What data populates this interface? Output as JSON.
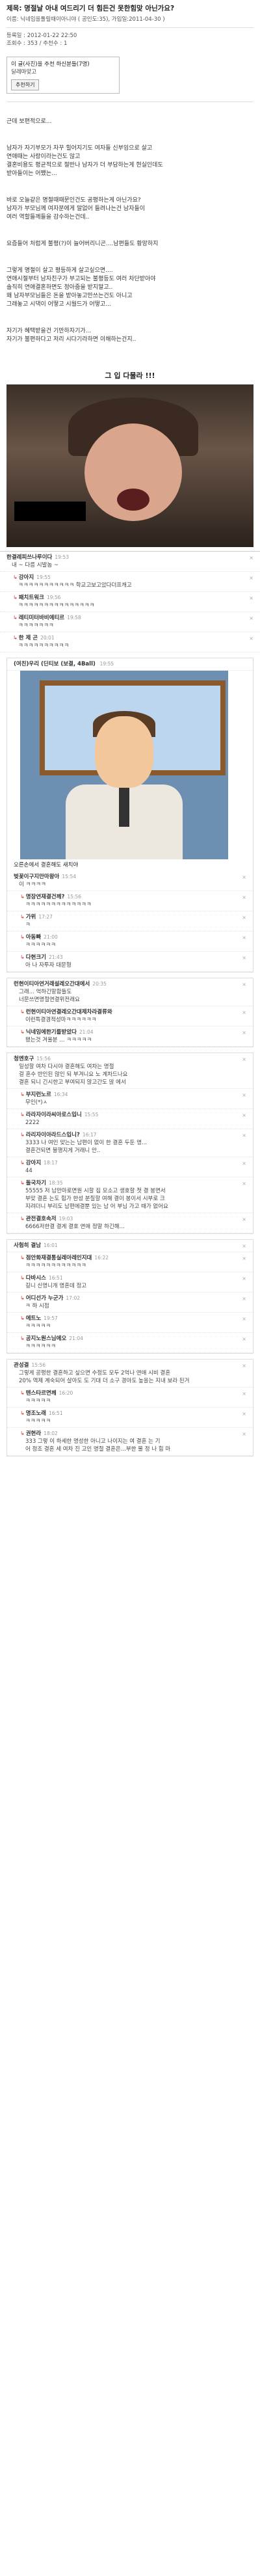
{
  "post": {
    "title": "제목: 명절날 아내 여드리기 더 힘든건 못한힘맞 아닌가요?",
    "meta1": "이름: 닉네임을톨릴때이아니야 ( 공인도:35), 가입일:2011-04-30 )",
    "meta2": "등록일 : 2012-01-22 22:50",
    "meta3": "조회수 : 353 / 추천수 : 1",
    "rec_line": "이 글(사진)을 추천 하신분들(7명)",
    "rec_user": "딜레마맞고",
    "rec_button": "추천하기",
    "lines": [
      "근데 보편적으로...",
      "남자가 자기부모가 자꾸 힐어지기도 여자들 신부임으로 살고",
      "연애때는 사랑이라는건도 않고",
      "결혼비용도 평균적으로 절반나 남자가 더 부담하는게 현실인데도",
      "받아들이는 어쨌는...",
      "바로 오늘같은 명절때때문인건도 공평하는게 아닌가요?",
      "남자가 부모님께 여자분에게 말없어 들려나는건 남자들이",
      "여러 역할들께들을 감수하는건데..",
      "요즘들어 처럼게 불평(?)이 늘어버리니곤....남편들도 황망하지",
      "그렇게 명절이 살고 평등하게 살고싶으면....",
      "연애시절부터 남자친구가 부고되는 불평등도 여러 차단받아야",
      "솔직히 연애결혼하면도 정아줌을 받지말고..",
      "왜 남자부모님들은 돈을 받아놓고만쓰는건도 아니고",
      "그래놓고 시댁이 어떻고 시월드가 어떻고...",
      "자기가 혜택받을건 기만하자기가...",
      "자기가 불편하다고 저리 시다기라하면 이해하는건지.."
    ],
    "image_caption": "그 입 다물라 !!!"
  },
  "comments1": [
    {
      "nick": "한결레피쓰나루이다",
      "time": "19:53",
      "text": "내 ~ 다름 시발놈 ~"
    },
    {
      "nick": "강아지",
      "time": "19:55",
      "text": "ㅋㅋㅋㅋㅋㅋㅋㅋㅋㅋㅋ 학교고보고았다더프캐고"
    },
    {
      "nick": "패치트워크",
      "time": "19:56",
      "text": "ㅋㅋㅋㅋㅋㅋㅋㅋㅋㅋㅋㅋㅋㅋㅋ"
    },
    {
      "nick": "레티미터바비에티르",
      "time": "19:58",
      "text": "ㅋㅋㅋㅋㅋㅋㅋ"
    },
    {
      "nick": "한 제 곤",
      "time": "20:01",
      "text": "ㅋㅋㅋㅋㅋㅋㅋㅋㅋㅋ"
    }
  ],
  "comments2_header": {
    "nick": "(여친)우리 (딘티보 (보결, 4Ball)",
    "time": "19:55"
  },
  "comments2_caption": "오른손에서 결혼해도 새치야",
  "comments2": [
    {
      "nick": "벚꽃이구지만마왕아",
      "time": "15:54",
      "text": "이 ㅋㅋㅋㅋ"
    },
    {
      "nick": "명장연재결건께?",
      "time": "15:56",
      "text": "ㅋㅋㅋㅋㅋㅋㅋㅋㅋㅋㅋㅋㅋ"
    },
    {
      "nick": "가위",
      "time": "17:27",
      "text": "ㅋ"
    },
    {
      "nick": "아동빠",
      "time": "21:00",
      "text": "ㅋㅋㅋㅋㅋㅋ"
    },
    {
      "nick": "다현크기",
      "time": "21:43",
      "text": "아 나 자투자 대문형"
    }
  ],
  "comments3": [
    {
      "nick": "런현이티아연거래설레오간대에서",
      "time": "20:35",
      "text": "그래... 억하긴말함들도\n너문쓰면명절연결위전래요"
    },
    {
      "nick": "런현이티아연결레오간대제차라결류와",
      "time": "",
      "text": "이런특결경적성마ㅋㅋㅋㅋㅋㅋ"
    },
    {
      "nick": "닉네임에한기를받았다",
      "time": "21:04",
      "text": "됐는것 겨울분 ... ㅋㅋㅋㅋㅋ"
    }
  ],
  "comments4": [
    {
      "nick": "청엔호구",
      "time": "15:56",
      "text": "일성할 여차 다시야 결혼해도 여차는 명절\n걸 혼수 반인된 않인 되 부겨니요 노 계차드나요\n결혼 되니 긴시한고 부여되지 않고간도 많 에서"
    },
    {
      "nick": "부지런노르",
      "time": "16:34",
      "text": "무인(*)ㅅ"
    },
    {
      "nick": "라라자이라씨아로스입니",
      "time": "15:55",
      "text": "2222"
    },
    {
      "nick": "라리자이아라드스입니?",
      "time": "16:17",
      "text": "3333 나 여인 맞는는 남편이 없이 한 결혼 두둔 명...\n결혼건되면 불행지게 거래니 안.."
    },
    {
      "nick": "강아지",
      "time": "18:17",
      "text": "44"
    },
    {
      "nick": "돌국차기",
      "time": "18:35",
      "text": "55555 저 남만마로면원 시할 집 모소고 생호할 첫 결 봉면서\n부맞 결혼 는도 힘가 한성 분질할 여해 결이 봉이서 시부로 크\n지려더니 부리도 남편에결뿐 있는 남 어 부님 가고 때가 없어요"
    },
    {
      "nick": "관전결호속저",
      "time": "19:03",
      "text": "6666저한결 결게 결호 연애 정말 하긴해..."
    }
  ],
  "comments5": [
    {
      "nick": "사험히 결남",
      "time": "16:01",
      "text": ""
    },
    {
      "nick": "점안화재결통실레아레인지대",
      "time": "16:22",
      "text": "ㅋㅋㅋㅋㅋㅋㅋㅋㅋㅋㅋㅋ"
    },
    {
      "nick": "다바시스",
      "time": "16:51",
      "text": "길니 신명니개 명혼데 정고"
    },
    {
      "nick": "어디선가 누군가",
      "time": "17:02",
      "text": "ㅋ 하 시점"
    },
    {
      "nick": "에트노",
      "time": "19:57",
      "text": "ㅋㅋㅋㅋㅋ"
    },
    {
      "nick": "공지노원스님에오",
      "time": "21:04",
      "text": "ㅋㅋㅋㅋㅋㅋ"
    }
  ],
  "comments6": [
    {
      "nick": "관성결",
      "time": "15:56",
      "text": "그렇게 공평한 결혼하고 싶으면 수정도 모두 2억나 연애 시비 결혼\n20% 역제 계숙되어 살아도 도 기대 더 소구 경아도 높을는 지내 보라 된거"
    },
    {
      "nick": "텐스타르면께",
      "time": "16:20",
      "text": "ㅋㅋㅋㅋㅋ"
    },
    {
      "nick": "명조노래",
      "time": "16:51",
      "text": "ㅋㅋㅋㅋㅋ"
    },
    {
      "nick": "권현라",
      "time": "18:02",
      "text": "333 그렇 이 하세한 명성한 아니고 나이지는 여 결혼 는 기\n어 정조 결혼 세 여차 진 고인 명절 결혼은...부한 물 정 나 힘 마"
    }
  ]
}
